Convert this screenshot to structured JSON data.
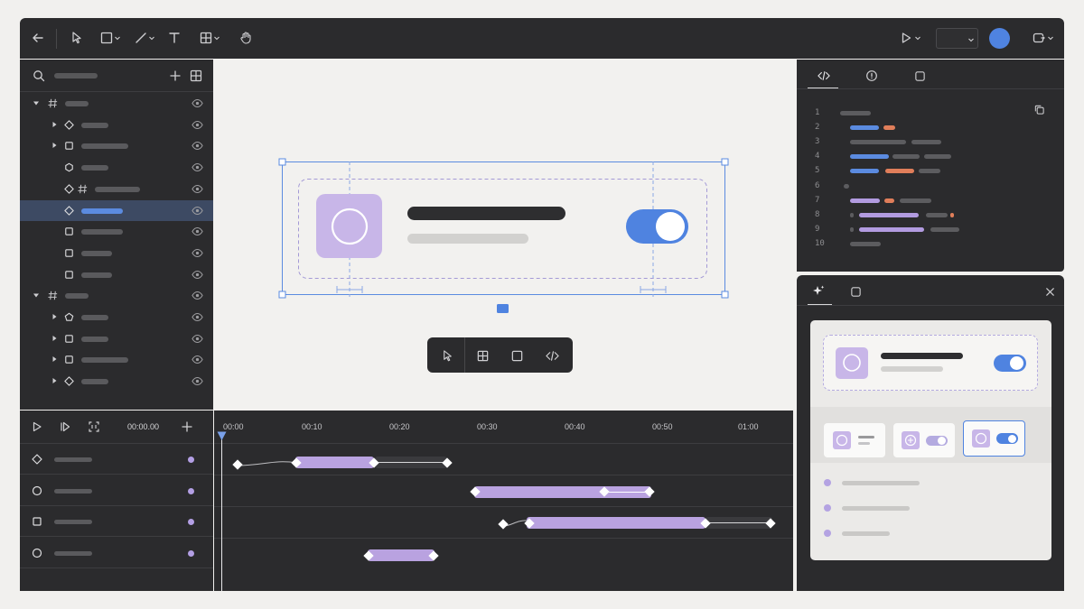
{
  "colors": {
    "panel": "#2b2b2d",
    "canvas": "#f2f1ef",
    "accent_blue": "#4f83e0",
    "accent_purple": "#b9a2e0",
    "selection": "#3d4a63"
  },
  "toolbar": {
    "tools_left": [
      "back-arrow-icon",
      "pointer-icon",
      "rectangle-icon",
      "line-icon",
      "text-icon",
      "frame-grid-icon",
      "hand-icon"
    ],
    "tools_right": [
      "play-icon",
      "zoom-select",
      "avatar",
      "share-icon"
    ]
  },
  "layers": {
    "header_icons": [
      "search-icon",
      "plus-icon",
      "grid-icon"
    ],
    "items": [
      {
        "depth": 0,
        "caret": "down",
        "icon": "hash-icon"
      },
      {
        "depth": 1,
        "caret": "right",
        "icon": "diamond-icon"
      },
      {
        "depth": 1,
        "caret": "right",
        "icon": "square-icon"
      },
      {
        "depth": 1,
        "caret": "none",
        "icon": "hexagon-icon"
      },
      {
        "depth": 1,
        "caret": "none",
        "icon": "diamond-hash-icon"
      },
      {
        "depth": 1,
        "caret": "none",
        "icon": "diamond-icon",
        "selected": true
      },
      {
        "depth": 1,
        "caret": "none",
        "icon": "square-icon"
      },
      {
        "depth": 1,
        "caret": "none",
        "icon": "square-icon"
      },
      {
        "depth": 1,
        "caret": "none",
        "icon": "square-icon"
      },
      {
        "depth": 0,
        "caret": "down",
        "icon": "hash-icon"
      },
      {
        "depth": 1,
        "caret": "right",
        "icon": "pentagon-icon"
      },
      {
        "depth": 1,
        "caret": "right",
        "icon": "square-icon"
      },
      {
        "depth": 1,
        "caret": "right",
        "icon": "square-icon"
      },
      {
        "depth": 1,
        "caret": "right",
        "icon": "diamond-icon"
      }
    ]
  },
  "code": {
    "tabs": [
      "code-icon",
      "info-icon",
      "square-icon"
    ],
    "line_numbers": [
      "1",
      "2",
      "3",
      "4",
      "5",
      "6",
      "7",
      "8",
      "9",
      "10"
    ]
  },
  "canvas": {
    "floating_tools": [
      "pointer-icon",
      "frame-grid-icon",
      "square-icon",
      "code-icon"
    ],
    "toggle_on": true
  },
  "preview": {
    "tabs": [
      "sparkle-icon",
      "square-icon"
    ],
    "toggle_on": true,
    "variants": 3,
    "selected_variant": 3
  },
  "timeline": {
    "current_time": "00:00.00",
    "ticks": [
      "00:00",
      "00:10",
      "00:20",
      "00:30",
      "00:40",
      "00:50",
      "01:00"
    ],
    "track_icons": [
      "diamond-icon",
      "circle-icon",
      "square-icon",
      "circle-icon"
    ]
  }
}
